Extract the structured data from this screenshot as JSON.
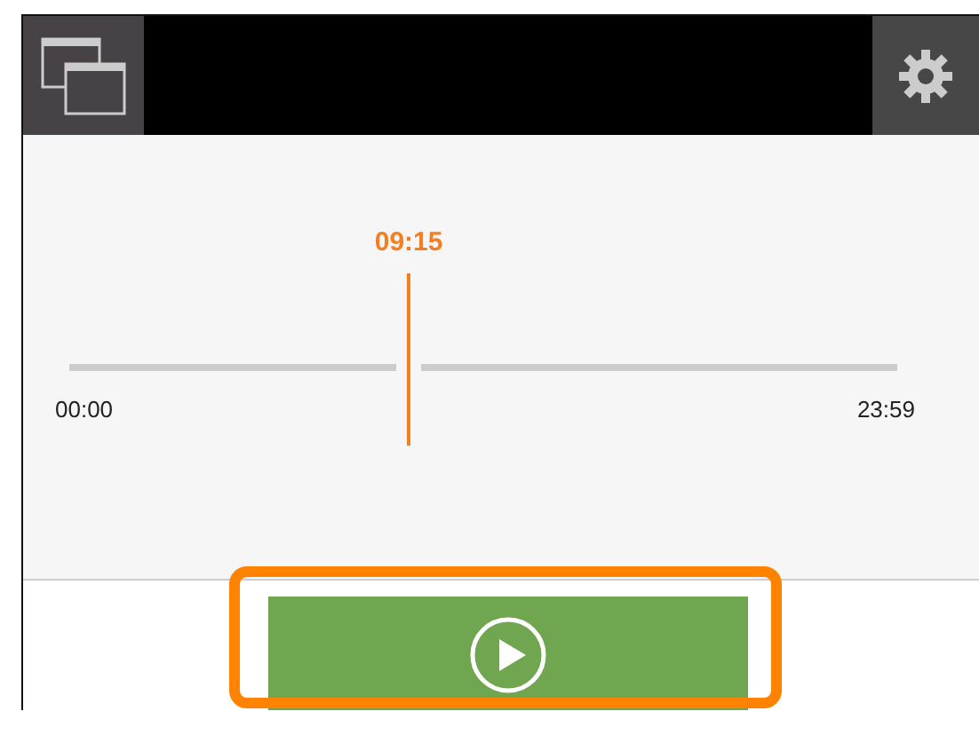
{
  "timeline": {
    "current_time": "09:15",
    "level": 0.41,
    "start_label": "00:00",
    "end_label": "23:59"
  },
  "play_button": {
    "highlighted": true
  }
}
